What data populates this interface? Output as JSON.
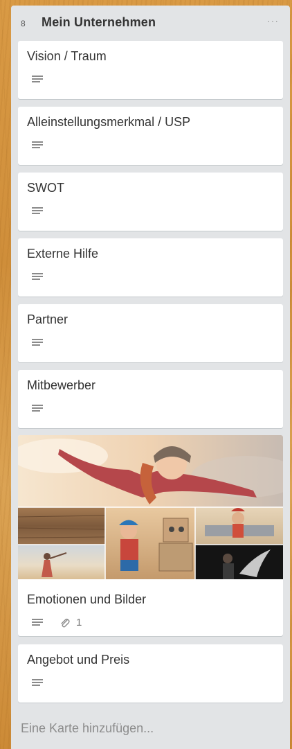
{
  "list": {
    "count": "8",
    "title": "Mein Unternehmen",
    "menu_label": "···",
    "add_card_label": "Eine Karte hinzufügen..."
  },
  "cards": [
    {
      "title": "Vision / Traum"
    },
    {
      "title": "Alleinstellungsmerkmal / USP"
    },
    {
      "title": "SWOT"
    },
    {
      "title": "Externe Hilfe"
    },
    {
      "title": "Partner"
    },
    {
      "title": "Mitbewerber"
    },
    {
      "title": "Emotionen und Bilder",
      "attachment_count": "1"
    },
    {
      "title": "Angebot und Preis"
    }
  ],
  "icons": {
    "description": "description-icon",
    "attachment": "paperclip-icon",
    "menu": "more-horizontal-icon"
  },
  "colors": {
    "list_background": "#e2e4e6",
    "card_background": "#ffffff",
    "board_background": "#d99a45"
  }
}
